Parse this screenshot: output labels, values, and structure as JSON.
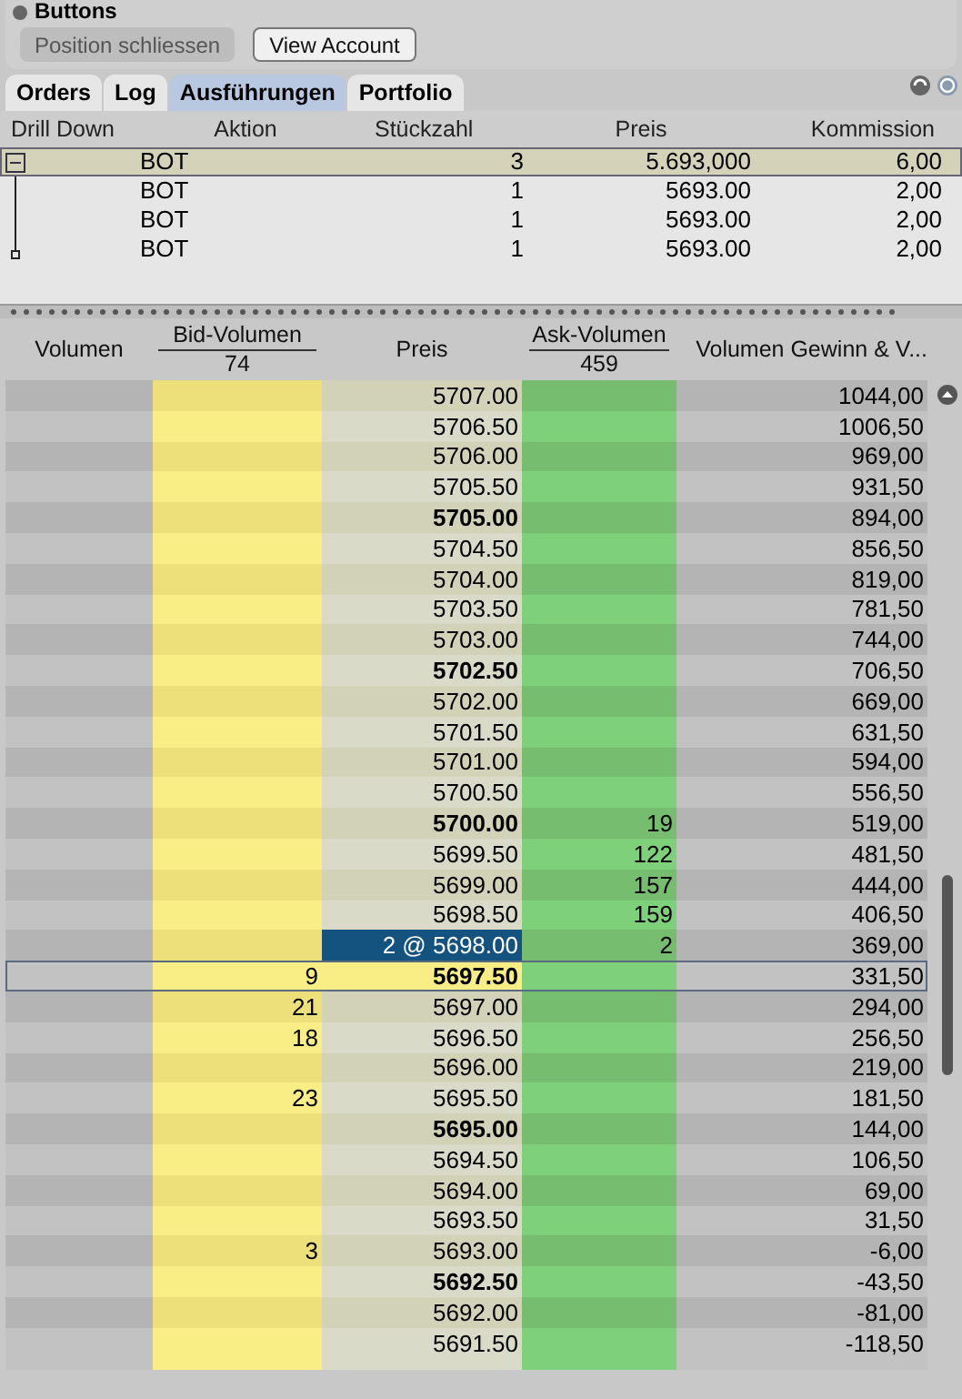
{
  "buttons_panel": {
    "title": "Buttons",
    "buttons": [
      {
        "label": "Position schliessen",
        "disabled": true
      },
      {
        "label": "View Account",
        "disabled": false
      }
    ]
  },
  "tabs": [
    {
      "label": "Orders",
      "selected": false
    },
    {
      "label": "Log",
      "selected": false
    },
    {
      "label": "Ausführungen",
      "selected": true
    },
    {
      "label": "Portfolio",
      "selected": false
    }
  ],
  "executions": {
    "columns": [
      "Drill Down",
      "Aktion",
      "Stückzahl",
      "Preis",
      "Kommission"
    ],
    "rows": [
      {
        "kind": "parent",
        "expanded": true,
        "action": "BOT",
        "qty": "3",
        "price": "5.693,000",
        "commission": "6,00",
        "selected": true
      },
      {
        "kind": "child",
        "action": "BOT",
        "qty": "1",
        "price": "5693.00",
        "commission": "2,00",
        "selected": false
      },
      {
        "kind": "child",
        "action": "BOT",
        "qty": "1",
        "price": "5693.00",
        "commission": "2,00",
        "selected": false
      },
      {
        "kind": "last",
        "action": "BOT",
        "qty": "1",
        "price": "5693.00",
        "commission": "2,00",
        "selected": false
      }
    ]
  },
  "ladder": {
    "columns": {
      "volume": "Volumen",
      "bid": "Bid-Volumen",
      "bid_total": "74",
      "price": "Preis",
      "ask": "Ask-Volumen",
      "ask_total": "459",
      "pnl": "Volumen Gewinn & V..."
    },
    "rows": [
      {
        "price": "5707.00",
        "bold": false,
        "bid": "",
        "ask": "",
        "pnl": "1044,00",
        "selected": false,
        "order": false
      },
      {
        "price": "5706.50",
        "bold": false,
        "bid": "",
        "ask": "",
        "pnl": "1006,50",
        "selected": false,
        "order": false
      },
      {
        "price": "5706.00",
        "bold": false,
        "bid": "",
        "ask": "",
        "pnl": "969,00",
        "selected": false,
        "order": false
      },
      {
        "price": "5705.50",
        "bold": false,
        "bid": "",
        "ask": "",
        "pnl": "931,50",
        "selected": false,
        "order": false
      },
      {
        "price": "5705.00",
        "bold": true,
        "bid": "",
        "ask": "",
        "pnl": "894,00",
        "selected": false,
        "order": false
      },
      {
        "price": "5704.50",
        "bold": false,
        "bid": "",
        "ask": "",
        "pnl": "856,50",
        "selected": false,
        "order": false
      },
      {
        "price": "5704.00",
        "bold": false,
        "bid": "",
        "ask": "",
        "pnl": "819,00",
        "selected": false,
        "order": false
      },
      {
        "price": "5703.50",
        "bold": false,
        "bid": "",
        "ask": "",
        "pnl": "781,50",
        "selected": false,
        "order": false
      },
      {
        "price": "5703.00",
        "bold": false,
        "bid": "",
        "ask": "",
        "pnl": "744,00",
        "selected": false,
        "order": false
      },
      {
        "price": "5702.50",
        "bold": true,
        "bid": "",
        "ask": "",
        "pnl": "706,50",
        "selected": false,
        "order": false
      },
      {
        "price": "5702.00",
        "bold": false,
        "bid": "",
        "ask": "",
        "pnl": "669,00",
        "selected": false,
        "order": false
      },
      {
        "price": "5701.50",
        "bold": false,
        "bid": "",
        "ask": "",
        "pnl": "631,50",
        "selected": false,
        "order": false
      },
      {
        "price": "5701.00",
        "bold": false,
        "bid": "",
        "ask": "",
        "pnl": "594,00",
        "selected": false,
        "order": false
      },
      {
        "price": "5700.50",
        "bold": false,
        "bid": "",
        "ask": "",
        "pnl": "556,50",
        "selected": false,
        "order": false
      },
      {
        "price": "5700.00",
        "bold": true,
        "bid": "",
        "ask": "19",
        "pnl": "519,00",
        "selected": false,
        "order": false
      },
      {
        "price": "5699.50",
        "bold": false,
        "bid": "",
        "ask": "122",
        "pnl": "481,50",
        "selected": false,
        "order": false
      },
      {
        "price": "5699.00",
        "bold": false,
        "bid": "",
        "ask": "157",
        "pnl": "444,00",
        "selected": false,
        "order": false
      },
      {
        "price": "5698.50",
        "bold": false,
        "bid": "",
        "ask": "159",
        "pnl": "406,50",
        "selected": false,
        "order": false
      },
      {
        "price": "2 @ 5698.00",
        "bold": false,
        "bid": "",
        "ask": "2",
        "pnl": "369,00",
        "selected": false,
        "order": true
      },
      {
        "price": "5697.50",
        "bold": true,
        "bid": "9",
        "ask": "",
        "pnl": "331,50",
        "selected": true,
        "order": false
      },
      {
        "price": "5697.00",
        "bold": false,
        "bid": "21",
        "ask": "",
        "pnl": "294,00",
        "selected": false,
        "order": false
      },
      {
        "price": "5696.50",
        "bold": false,
        "bid": "18",
        "ask": "",
        "pnl": "256,50",
        "selected": false,
        "order": false
      },
      {
        "price": "5696.00",
        "bold": false,
        "bid": "",
        "ask": "",
        "pnl": "219,00",
        "selected": false,
        "order": false
      },
      {
        "price": "5695.50",
        "bold": false,
        "bid": "23",
        "ask": "",
        "pnl": "181,50",
        "selected": false,
        "order": false
      },
      {
        "price": "5695.00",
        "bold": true,
        "bid": "",
        "ask": "",
        "pnl": "144,00",
        "selected": false,
        "order": false
      },
      {
        "price": "5694.50",
        "bold": false,
        "bid": "",
        "ask": "",
        "pnl": "106,50",
        "selected": false,
        "order": false
      },
      {
        "price": "5694.00",
        "bold": false,
        "bid": "",
        "ask": "",
        "pnl": "69,00",
        "selected": false,
        "order": false
      },
      {
        "price": "5693.50",
        "bold": false,
        "bid": "",
        "ask": "",
        "pnl": "31,50",
        "selected": false,
        "order": false
      },
      {
        "price": "5693.00",
        "bold": false,
        "bid": "3",
        "ask": "",
        "pnl": "-6,00",
        "selected": false,
        "order": false
      },
      {
        "price": "5692.50",
        "bold": true,
        "bid": "",
        "ask": "",
        "pnl": "-43,50",
        "selected": false,
        "order": false
      },
      {
        "price": "5692.00",
        "bold": false,
        "bid": "",
        "ask": "",
        "pnl": "-81,00",
        "selected": false,
        "order": false
      },
      {
        "price": "5691.50",
        "bold": false,
        "bid": "",
        "ask": "",
        "pnl": "-118,50",
        "selected": false,
        "order": false
      }
    ]
  }
}
